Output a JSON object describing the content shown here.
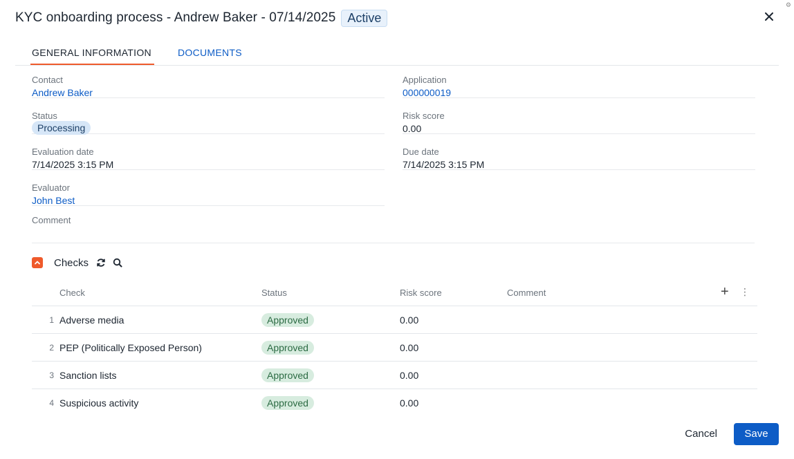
{
  "header": {
    "title": "KYC onboarding process - Andrew Baker - 07/14/2025",
    "badge": "Active",
    "close_icon": "close-icon"
  },
  "tabs": [
    {
      "label": "GENERAL INFORMATION",
      "active": true
    },
    {
      "label": "DOCUMENTS",
      "active": false
    }
  ],
  "fields": {
    "contact": {
      "label": "Contact",
      "value": "Andrew Baker"
    },
    "application": {
      "label": "Application",
      "value": "000000019"
    },
    "status": {
      "label": "Status",
      "value": "Processing"
    },
    "risk_score": {
      "label": "Risk score",
      "value": "0.00"
    },
    "evaluation_date": {
      "label": "Evaluation date",
      "value": "7/14/2025 3:15 PM"
    },
    "due_date": {
      "label": "Due date",
      "value": "7/14/2025 3:15 PM"
    },
    "evaluator": {
      "label": "Evaluator",
      "value": "John Best"
    },
    "comment": {
      "label": "Comment",
      "value": ""
    }
  },
  "checks": {
    "title": "Checks",
    "columns": [
      "Check",
      "Status",
      "Risk score",
      "Comment"
    ],
    "rows": [
      {
        "num": "1",
        "check": "Adverse media",
        "status": "Approved",
        "risk": "0.00",
        "comment": ""
      },
      {
        "num": "2",
        "check": "PEP (Politically Exposed Person)",
        "status": "Approved",
        "risk": "0.00",
        "comment": ""
      },
      {
        "num": "3",
        "check": "Sanction lists",
        "status": "Approved",
        "risk": "0.00",
        "comment": ""
      },
      {
        "num": "4",
        "check": "Suspicious activity",
        "status": "Approved",
        "risk": "0.00",
        "comment": ""
      }
    ]
  },
  "footer": {
    "cancel_label": "Cancel",
    "save_label": "Save"
  },
  "colors": {
    "accent": "#ef5a2b",
    "primary": "#0d5cc6",
    "approved_bg": "#d7ecdf",
    "processing_bg": "#d6e6f7"
  }
}
